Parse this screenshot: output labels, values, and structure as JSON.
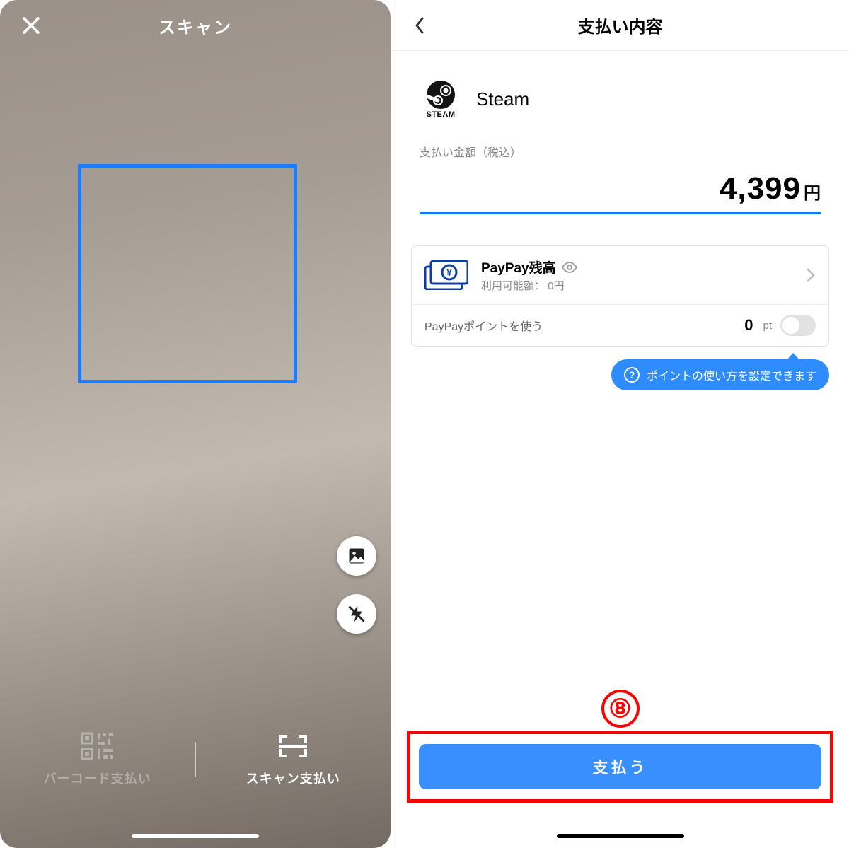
{
  "left": {
    "title": "スキャン",
    "modes": {
      "barcode": "バーコード支払い",
      "scan": "スキャン支払い"
    }
  },
  "right": {
    "title": "支払い内容",
    "merchant": {
      "name": "Steam",
      "logoText": "STEAM"
    },
    "amount": {
      "label": "支払い金額（税込）",
      "value": "4,399",
      "unit": "円"
    },
    "method": {
      "balanceTitle": "PayPay残高",
      "balanceSub": "利用可能額： 0円",
      "pointsLabel": "PayPayポイントを使う",
      "pointsValue": "0",
      "pointsUnit": "pt"
    },
    "tooltip": "ポイントの使い方を設定できます",
    "payButton": "支払う",
    "annotation": "⑧"
  }
}
